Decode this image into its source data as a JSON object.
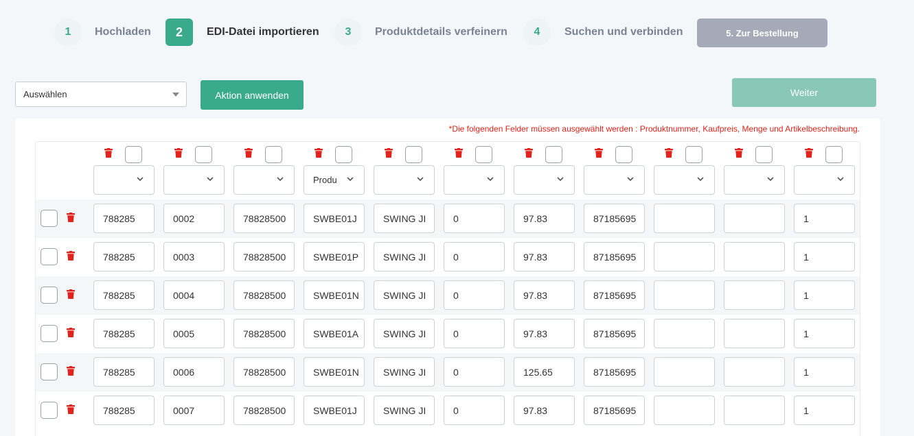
{
  "steps": [
    {
      "number": "1",
      "label": "Hochladen"
    },
    {
      "number": "2",
      "label": "EDI-Datei importieren"
    },
    {
      "number": "3",
      "label": "Produktdetails verfeinern"
    },
    {
      "number": "4",
      "label": "Suchen und verbinden"
    }
  ],
  "final_step_label": "5. Zur Bestellung",
  "toolbar": {
    "select_value": "Auswählen",
    "apply_label": "Aktion anwenden",
    "next_label": "Weiter"
  },
  "notice": "*Die folgenden Felder müssen ausgewählt werden : Produktnummer, Kaufpreis, Menge und Artikelbeschreibung.",
  "column_selects": [
    "",
    "",
    "",
    "Produ",
    "",
    "",
    "",
    "",
    "",
    "",
    ""
  ],
  "rows": [
    [
      "788285",
      "0002",
      "78828500",
      "SWBE01J",
      "SWING JI",
      "0",
      "97.83",
      "87185695",
      "",
      "",
      "1"
    ],
    [
      "788285",
      "0003",
      "78828500",
      "SWBE01P",
      "SWING JI",
      "0",
      "97.83",
      "87185695",
      "",
      "",
      "1"
    ],
    [
      "788285",
      "0004",
      "78828500",
      "SWBE01N",
      "SWING JI",
      "0",
      "97.83",
      "87185695",
      "",
      "",
      "1"
    ],
    [
      "788285",
      "0005",
      "78828500",
      "SWBE01A",
      "SWING JI",
      "0",
      "97.83",
      "87185695",
      "",
      "",
      "1"
    ],
    [
      "788285",
      "0006",
      "78828500",
      "SWBE01N",
      "SWING JI",
      "0",
      "125.65",
      "87185695",
      "",
      "",
      "1"
    ],
    [
      "788285",
      "0007",
      "78828500",
      "SWBE01J",
      "SWING JI",
      "0",
      "97.83",
      "87185695",
      "",
      "",
      "1"
    ]
  ],
  "colors": {
    "accent": "#3aaa8c",
    "danger": "#e0231c",
    "disabled": "#a6a9b8"
  }
}
